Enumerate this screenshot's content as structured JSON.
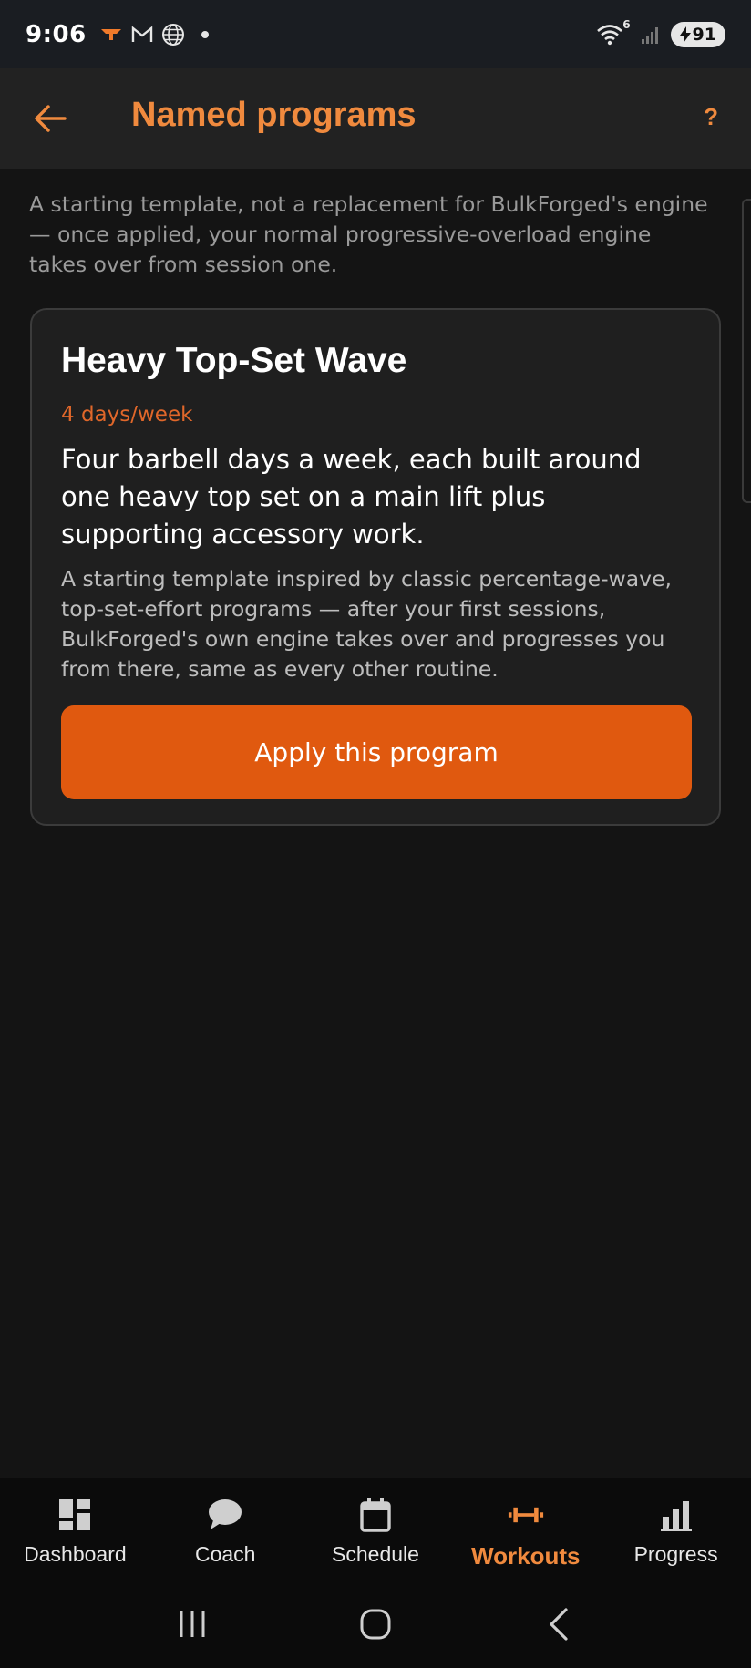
{
  "status_bar": {
    "time": "9:06",
    "battery": "91",
    "signal_sup": "6"
  },
  "app_bar": {
    "title": "Named programs",
    "help": "?"
  },
  "intro": "A starting template, not a replacement for BulkForged's engine — once applied, your normal progressive-overload engine takes over from session one.",
  "program_card": {
    "title": "Heavy Top-Set Wave",
    "frequency": "4 days/week",
    "summary": "Four barbell days a week, each built around one heavy top set on a main lift plus supporting accessory work.",
    "detail": "A starting template inspired by classic percentage-wave, top-set-effort programs — after your first sessions, BulkForged's own engine takes over and progresses you from there, same as every other routine.",
    "apply_label": "Apply this program"
  },
  "bottom_nav": {
    "items": [
      {
        "label": "Dashboard",
        "icon": "dashboard-icon",
        "active": false
      },
      {
        "label": "Coach",
        "icon": "chat-bubble-icon",
        "active": false
      },
      {
        "label": "Schedule",
        "icon": "calendar-icon",
        "active": false
      },
      {
        "label": "Workouts",
        "icon": "dumbbell-icon",
        "active": true
      },
      {
        "label": "Progress",
        "icon": "bar-chart-icon",
        "active": false
      }
    ]
  },
  "colors": {
    "accent": "#f08a3e",
    "button": "#e0590f",
    "background": "#141414"
  }
}
